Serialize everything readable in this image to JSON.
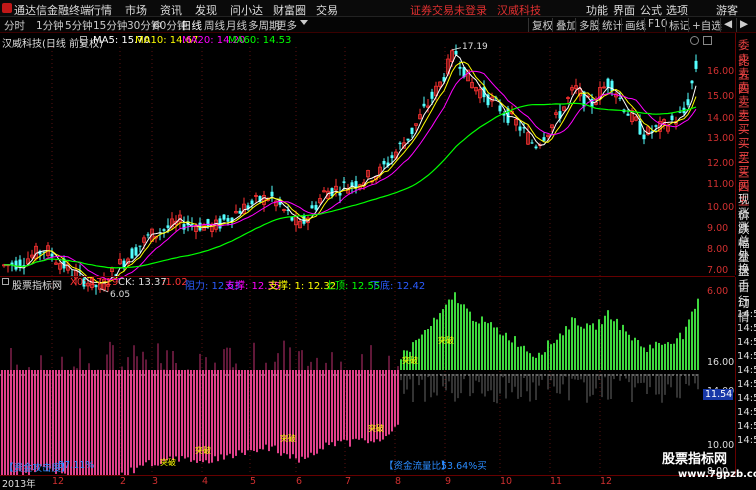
{
  "titlebar": {
    "app_title": "通达信金融终端",
    "menus": [
      "行情",
      "市场",
      "资讯",
      "发现",
      "问小达",
      "财富圈",
      "交易"
    ],
    "broker_alert": "证券交易未登录",
    "stock_name": "汉威科技",
    "right_items": [
      "功能",
      "界面",
      "公式",
      "选项",
      "游客"
    ]
  },
  "toolbar": {
    "periods": [
      "分时",
      "1分钟",
      "5分钟",
      "15分钟",
      "30分钟",
      "60分钟",
      "日线",
      "周线",
      "月线",
      "多周期",
      "更多"
    ],
    "active_period": "日线",
    "right_buttons": [
      "复权",
      "叠加",
      "多股",
      "统计",
      "画线",
      "F10",
      "标记",
      "+自选"
    ],
    "nav_arrows": [
      "◀",
      "▶"
    ]
  },
  "chart_info": {
    "stock_label": "汉威科技(日线 前复权)",
    "ma5": "MA5: 15.70",
    "ma10": "MA10: 14.67",
    "ma20": "MA20: 14.20",
    "ma60": "MA60: 14.53",
    "high_mark": "17.19",
    "low_mark": "6.05"
  },
  "price_axis": [
    "16.00",
    "15.00",
    "14.00",
    "13.00",
    "12.00",
    "11.00",
    "10.00",
    "9.00",
    "8.00",
    "7.00",
    "6.00"
  ],
  "right_panel": [
    "委比",
    "卖五",
    "卖四",
    "卖三",
    "卖二",
    "卖一",
    "买一",
    "买二",
    "买三",
    "买四",
    "买五",
    "现价",
    "涨跌",
    "涨幅",
    "总量",
    "外盘",
    "换手",
    "净资",
    "收益"
  ],
  "indicator": {
    "name": "股票指标网",
    "x0": "X0: 17.19",
    "ck": "CK: 13.37",
    "v1": ":1.02",
    "zudang": "阻力: 12.63",
    "zhicheng": "支撑: 12.35",
    "zhicheng2": "支撑: 1: 12.32",
    "shangding": "上顶: 12.55",
    "xiadi": "下底: 12.42",
    "axis": [
      "16.00",
      "14.00",
      "11.54",
      "10.00",
      "8.00"
    ],
    "marker_value": "11.54",
    "label_attack": "【资金攻击度】",
    "label_attack_val": "57.11%",
    "label_flow": "【资金流量比】",
    "label_flow_val": "53.64%买",
    "signal_buy": "买",
    "signal_break": "突破"
  },
  "right_panel_lower": [
    "自动",
    "行情",
    "14:50",
    "14:50",
    "14:50",
    "14:50",
    "14:50",
    "14:50",
    "14:50",
    "14:50",
    "14:50",
    "14:50"
  ],
  "x_axis": [
    "2013年",
    "12",
    "2",
    "3",
    "4",
    "5",
    "6",
    "7",
    "8",
    "9",
    "10",
    "11",
    "12"
  ],
  "watermark": {
    "line1": "股票指标网",
    "line2": "www.7gpzb.com"
  },
  "colors": {
    "up": "#ff3232",
    "down": "#54ffff",
    "ma5": "#ffffff",
    "ma10": "#ffff00",
    "ma20": "#ff00ff",
    "ma60": "#00ff00",
    "pink": "#e0408a",
    "green": "#3ed83e"
  }
}
